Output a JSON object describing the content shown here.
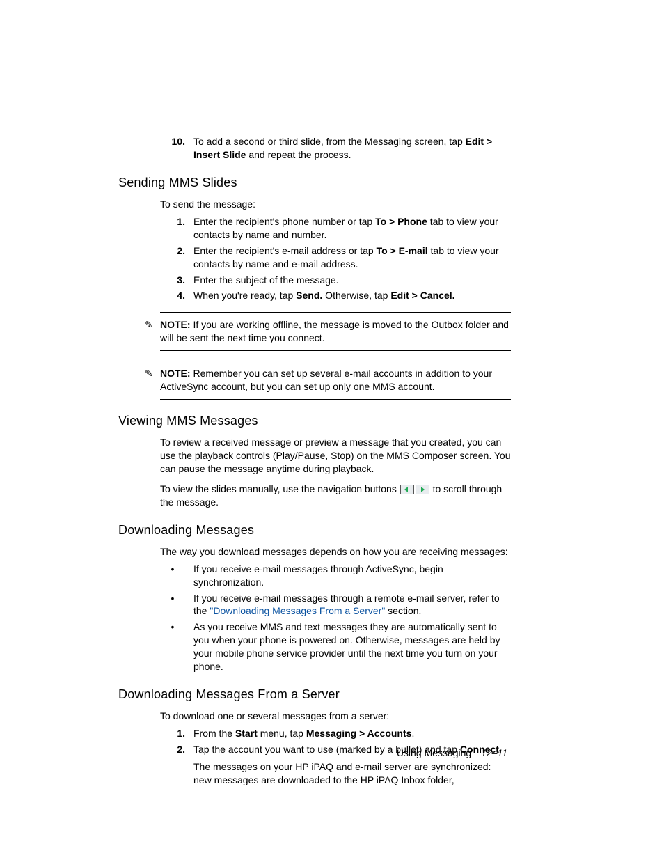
{
  "step10": {
    "num": "10.",
    "text_a": "To add a second or third slide, from the Messaging screen, tap ",
    "bold_a": "Edit > Insert Slide",
    "text_b": " and repeat the process."
  },
  "sec1": {
    "title": "Sending MMS Slides",
    "intro": "To send the message:",
    "steps": [
      {
        "num": "1.",
        "a": "Enter the recipient's phone number or tap ",
        "b": "To > Phone",
        "c": " tab to view your contacts by name and number."
      },
      {
        "num": "2.",
        "a": "Enter the recipient's e-mail address or tap ",
        "b": "To > E-mail",
        "c": " tab to view your contacts by name and e-mail address."
      },
      {
        "num": "3.",
        "a": "Enter the subject of the message.",
        "b": "",
        "c": ""
      },
      {
        "num": "4.",
        "a": "When you're ready, tap ",
        "b": "Send.",
        "c": " Otherwise, tap ",
        "d": "Edit > Cancel."
      }
    ],
    "note1_label": "NOTE:",
    "note1": " If you are working offline, the message is moved to the Outbox folder and will be sent the next time you connect.",
    "note2_label": "NOTE:",
    "note2": " Remember you can set up several e-mail accounts in addition to your ActiveSync account, but you can set up only one MMS account."
  },
  "sec2": {
    "title": "Viewing MMS Messages",
    "p1": "To review a received message or preview a message that you created, you can use the playback controls (Play/Pause, Stop) on the MMS Composer screen. You can pause the message anytime during playback.",
    "p2a": "To view the slides manually, use the navigation buttons ",
    "p2b": " to scroll through the message."
  },
  "sec3": {
    "title": "Downloading Messages",
    "p1": "The way you download messages depends on how you are receiving messages:",
    "bullets": [
      {
        "text": "If you receive e-mail messages through ActiveSync, begin synchronization."
      },
      {
        "a": "If you receive e-mail messages through a remote e-mail server, refer to the ",
        "link": "\"Downloading Messages From a Server\"",
        "b": " section."
      },
      {
        "text": "As you receive MMS and text messages they are automatically sent to you when your phone is powered on. Otherwise, messages are held by your mobile phone service provider until the next time you turn on your phone."
      }
    ]
  },
  "sec4": {
    "title": "Downloading Messages From a Server",
    "p1": "To download one or several messages from a server:",
    "steps": [
      {
        "num": "1.",
        "a": "From the ",
        "b": "Start",
        "c": " menu, tap ",
        "d": "Messaging > Accounts",
        "e": "."
      },
      {
        "num": "2.",
        "a": "Tap the account you want to use (marked by a bullet) and tap ",
        "b": "Connect.",
        "c": ""
      }
    ],
    "p2": "The messages on your HP iPAQ and e-mail server are synchronized: new messages are downloaded to the HP iPAQ Inbox folder,"
  },
  "footer": {
    "section": "Using Messaging",
    "page": "12–11"
  },
  "icons": {
    "note": "✎",
    "bullet": "•"
  }
}
